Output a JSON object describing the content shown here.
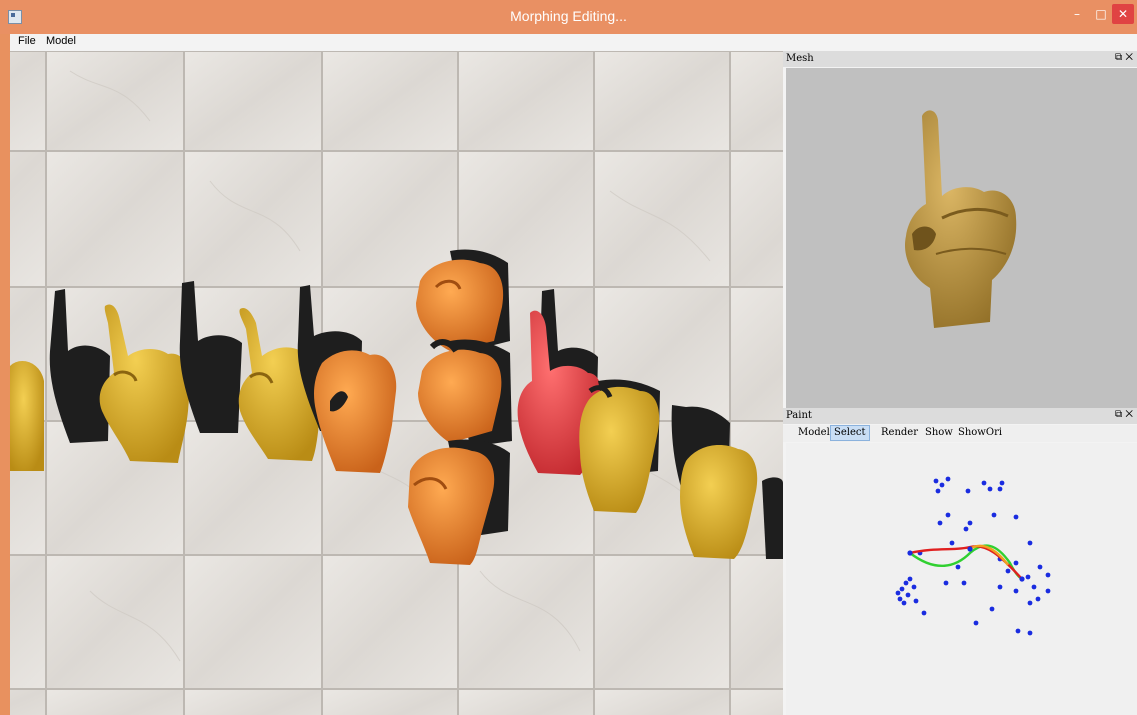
{
  "window": {
    "title": "Morphing Editing...",
    "min_glyph": "–",
    "max_glyph": "□",
    "close_glyph": "✕"
  },
  "menu": {
    "items": [
      "File",
      "Model"
    ]
  },
  "dock": {
    "mesh_title": "Mesh",
    "paint_title": "Paint",
    "float_glyph": "⧉",
    "close_glyph": "✕",
    "paint_tabs": [
      "Model",
      "Select",
      "Render",
      "Show",
      "ShowOri"
    ],
    "active_tab": "Select"
  },
  "colors": {
    "titlebar": "#e99063",
    "close_button": "#e04343",
    "hand_yellow": "#e2b42e",
    "hand_orange": "#f08a2c",
    "hand_red": "#e8464a",
    "mesh_hand": "#c8a24a",
    "point_blue": "#1a2ce0",
    "curve_red": "#e02020",
    "curve_green": "#30d030",
    "curve_orange": "#f0a020"
  },
  "icons": [
    "app-icon",
    "minimize-icon",
    "maximize-icon",
    "close-icon",
    "float-icon"
  ]
}
